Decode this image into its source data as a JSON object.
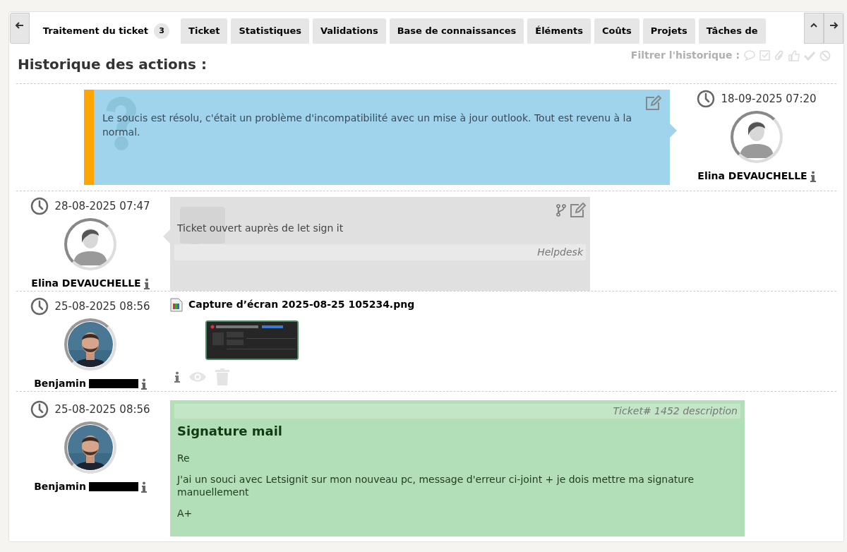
{
  "tabs": [
    {
      "label": "Traitement du ticket",
      "badge": "3",
      "selected": true
    },
    {
      "label": "Ticket",
      "selected": false
    },
    {
      "label": "Statistiques",
      "selected": false
    },
    {
      "label": "Validations",
      "selected": false
    },
    {
      "label": "Base de connaissances",
      "selected": false
    },
    {
      "label": "Éléments",
      "selected": false
    },
    {
      "label": "Coûts",
      "selected": false
    },
    {
      "label": "Projets",
      "selected": false
    },
    {
      "label": "Tâches de",
      "selected": false
    }
  ],
  "heading": "Historique des actions :",
  "filter": {
    "label": "Filtrer l'historique :"
  },
  "entries": [
    {
      "kind": "solution",
      "date": "18-09-2025 07:20",
      "author": {
        "name": "Elina DEVAUCHELLE",
        "avatar": {
          "kind": "placeholder"
        },
        "redacted": false
      },
      "text": "Le soucis est résolu, c'était un problème d'incompatibilité avec un mise à jour outlook. Tout est revenu à la normal."
    },
    {
      "kind": "followup",
      "date": "28-08-2025 07:47",
      "author": {
        "name": "Elina DEVAUCHELLE",
        "avatar": {
          "kind": "placeholder"
        },
        "redacted": false
      },
      "text": "Ticket ouvert auprès de let sign it",
      "source": "Helpdesk"
    },
    {
      "kind": "document",
      "date": "25-08-2025 08:56",
      "author": {
        "name": "Benjamin",
        "redacted": true
      },
      "filename": "Capture d’écran 2025-08-25 105234.png"
    },
    {
      "kind": "description",
      "date": "25-08-2025 08:56",
      "author": {
        "name": "Benjamin",
        "redacted": true
      },
      "header": "Ticket# 1452 description",
      "title": "Signature mail",
      "paragraphs": [
        "Re",
        "J'ai un souci avec Letsignit sur mon nouveau pc, message d'erreur ci-joint + je dois mettre ma signature manuellement",
        "A+"
      ]
    }
  ]
}
